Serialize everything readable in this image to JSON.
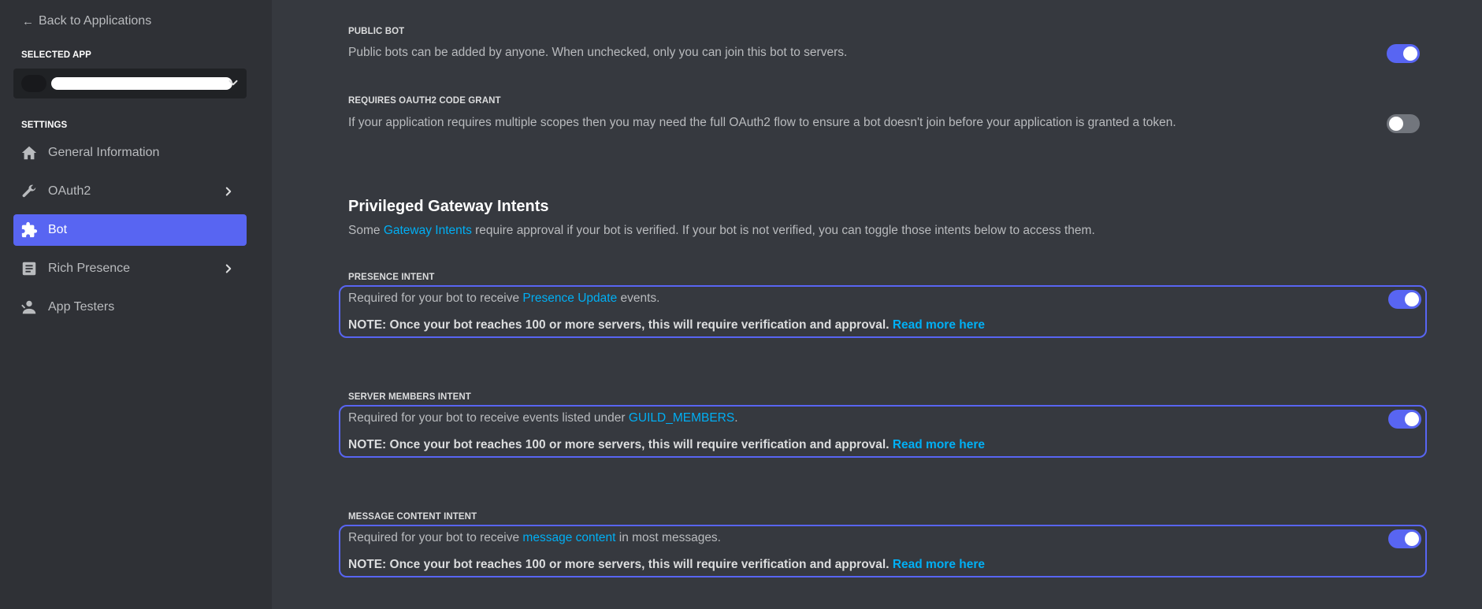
{
  "sidebar": {
    "back_label": "Back to Applications",
    "selected_app_label": "SELECTED APP",
    "settings_label": "SETTINGS",
    "items": [
      {
        "label": "General Information",
        "icon": "home-icon"
      },
      {
        "label": "OAuth2",
        "icon": "wrench-icon"
      },
      {
        "label": "Bot",
        "icon": "puzzle-icon",
        "active": true
      },
      {
        "label": "Rich Presence",
        "icon": "document-icon"
      },
      {
        "label": "App Testers",
        "icon": "person-icon"
      }
    ]
  },
  "main": {
    "public_bot": {
      "label": "PUBLIC BOT",
      "description": "Public bots can be added by anyone. When unchecked, only you can join this bot to servers.",
      "enabled": true
    },
    "oauth2_grant": {
      "label": "REQUIRES OAUTH2 CODE GRANT",
      "description": "If your application requires multiple scopes then you may need the full OAuth2 flow to ensure a bot doesn't join before your application is granted a token.",
      "enabled": false
    },
    "intents_section": {
      "title": "Privileged Gateway Intents",
      "desc_before": "Some ",
      "desc_link": "Gateway Intents",
      "desc_after": " require approval if your bot is verified. If your bot is not verified, you can toggle those intents below to access them."
    },
    "intents": [
      {
        "label": "PRESENCE INTENT",
        "text_before": "Required for your bot to receive ",
        "text_link": "Presence Update",
        "text_after": " events.",
        "note": "NOTE: Once your bot reaches 100 or more servers, this will require verification and approval. ",
        "note_link": "Read more here",
        "enabled": true
      },
      {
        "label": "SERVER MEMBERS INTENT",
        "text_before": "Required for your bot to receive events listed under ",
        "text_link": "GUILD_MEMBERS",
        "text_after": ".",
        "note": "NOTE: Once your bot reaches 100 or more servers, this will require verification and approval. ",
        "note_link": "Read more here",
        "enabled": true
      },
      {
        "label": "MESSAGE CONTENT INTENT",
        "text_before": "Required for your bot to receive ",
        "text_link": "message content",
        "text_after": " in most messages.",
        "note": "NOTE: Once your bot reaches 100 or more servers, this will require verification and approval. ",
        "note_link": "Read more here",
        "enabled": true
      }
    ]
  },
  "colors": {
    "accent": "#5865f2",
    "link": "#00aff4",
    "sidebar_bg": "#2f3136",
    "main_bg": "#36393f"
  }
}
